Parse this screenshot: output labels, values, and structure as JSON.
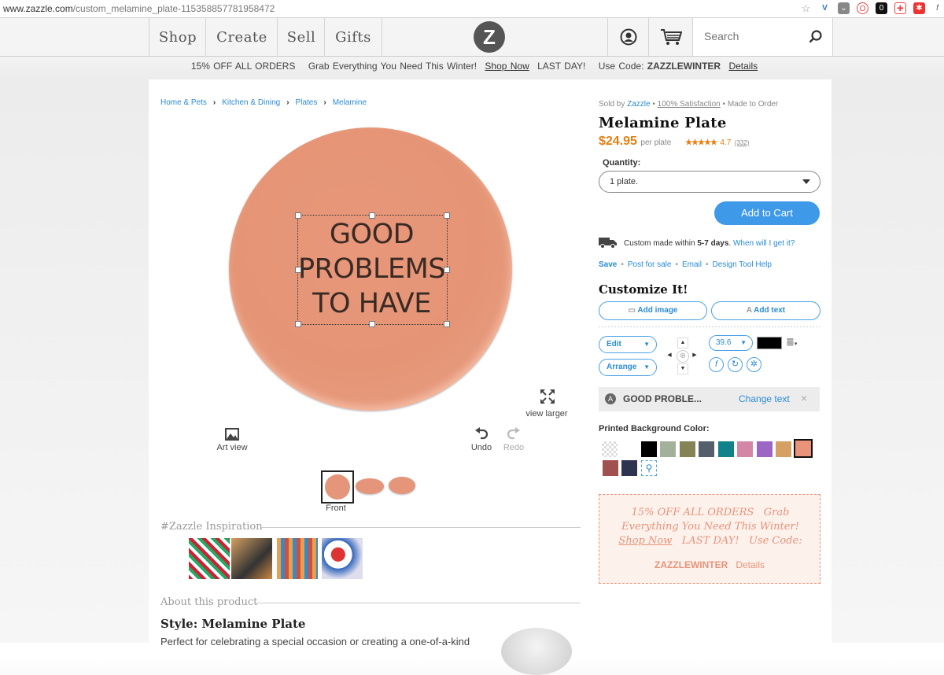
{
  "browser": {
    "url_domain": "www.zazzle.com",
    "url_path": "/custom_melamine_plate-115358857781958472"
  },
  "header": {
    "nav": [
      "Shop",
      "Create",
      "Sell",
      "Gifts"
    ],
    "logo": "Z",
    "search_placeholder": "Search"
  },
  "promo": {
    "offer": "15% OFF ALL ORDERS",
    "message": "Grab Everything You Need This Winter!",
    "shop_now": "Shop Now",
    "last_day": "LAST DAY!",
    "code_label": "Use Code:",
    "code": "ZAZZLEWINTER",
    "details": "Details"
  },
  "breadcrumb": [
    "Home & Pets",
    "Kitchen & Dining",
    "Plates",
    "Melamine"
  ],
  "design": {
    "line1": "GOOD",
    "line2": "PROBLEMS",
    "line3": "TO HAVE",
    "plate_color": "#e5957a"
  },
  "tools": {
    "art_view": "Art view",
    "undo": "Undo",
    "redo": "Redo",
    "view_larger": "view larger",
    "front": "Front"
  },
  "inspiration": {
    "title": "#Zazzle Inspiration"
  },
  "about": {
    "title": "About this product",
    "style": "Style: Melamine Plate",
    "desc": "Perfect for celebrating a special occasion or creating a one-of-a-kind"
  },
  "product": {
    "sold_by": "Sold by",
    "seller": "Zazzle",
    "satisfaction": "100% Satisfaction",
    "made_to_order": "Made to Order",
    "name": "Melamine Plate",
    "price": "$24.95",
    "per": "per plate",
    "rating": "4.7",
    "reviews": "(332)",
    "quantity_label": "Quantity:",
    "quantity_value": "1 plate.",
    "add_to_cart": "Add to Cart",
    "shipping": "Custom made within",
    "shipping_days": "5-7 days",
    "when": "When will I get it?",
    "links": [
      "Save",
      "Post for sale",
      "Email",
      "Design Tool Help"
    ]
  },
  "customize": {
    "title": "Customize It!",
    "add_image": "Add image",
    "add_text": "Add text",
    "edit": "Edit",
    "arrange": "Arrange",
    "font_size": "39.6",
    "text_color": "#000000",
    "selected_text": "GOOD PROBLE...",
    "change_text": "Change text",
    "bg_label": "Printed Background Color:",
    "swatches": [
      "transparent",
      "#ffffff",
      "#000000",
      "#a3b09a",
      "#858356",
      "#555f6b",
      "#11828a",
      "#d486a6",
      "#9b66c4",
      "#d6a064",
      "#e8937a",
      "#a0504f",
      "#2e3350",
      "picker"
    ]
  },
  "coupon": {
    "text1": "15% OFF ALL ORDERS",
    "text2": "Grab Everything You Need This Winter!",
    "shop_now": "Shop Now",
    "last_day": "LAST DAY!",
    "use_code": "Use Code:",
    "code": "ZAZZLEWINTER",
    "details": "Details"
  }
}
